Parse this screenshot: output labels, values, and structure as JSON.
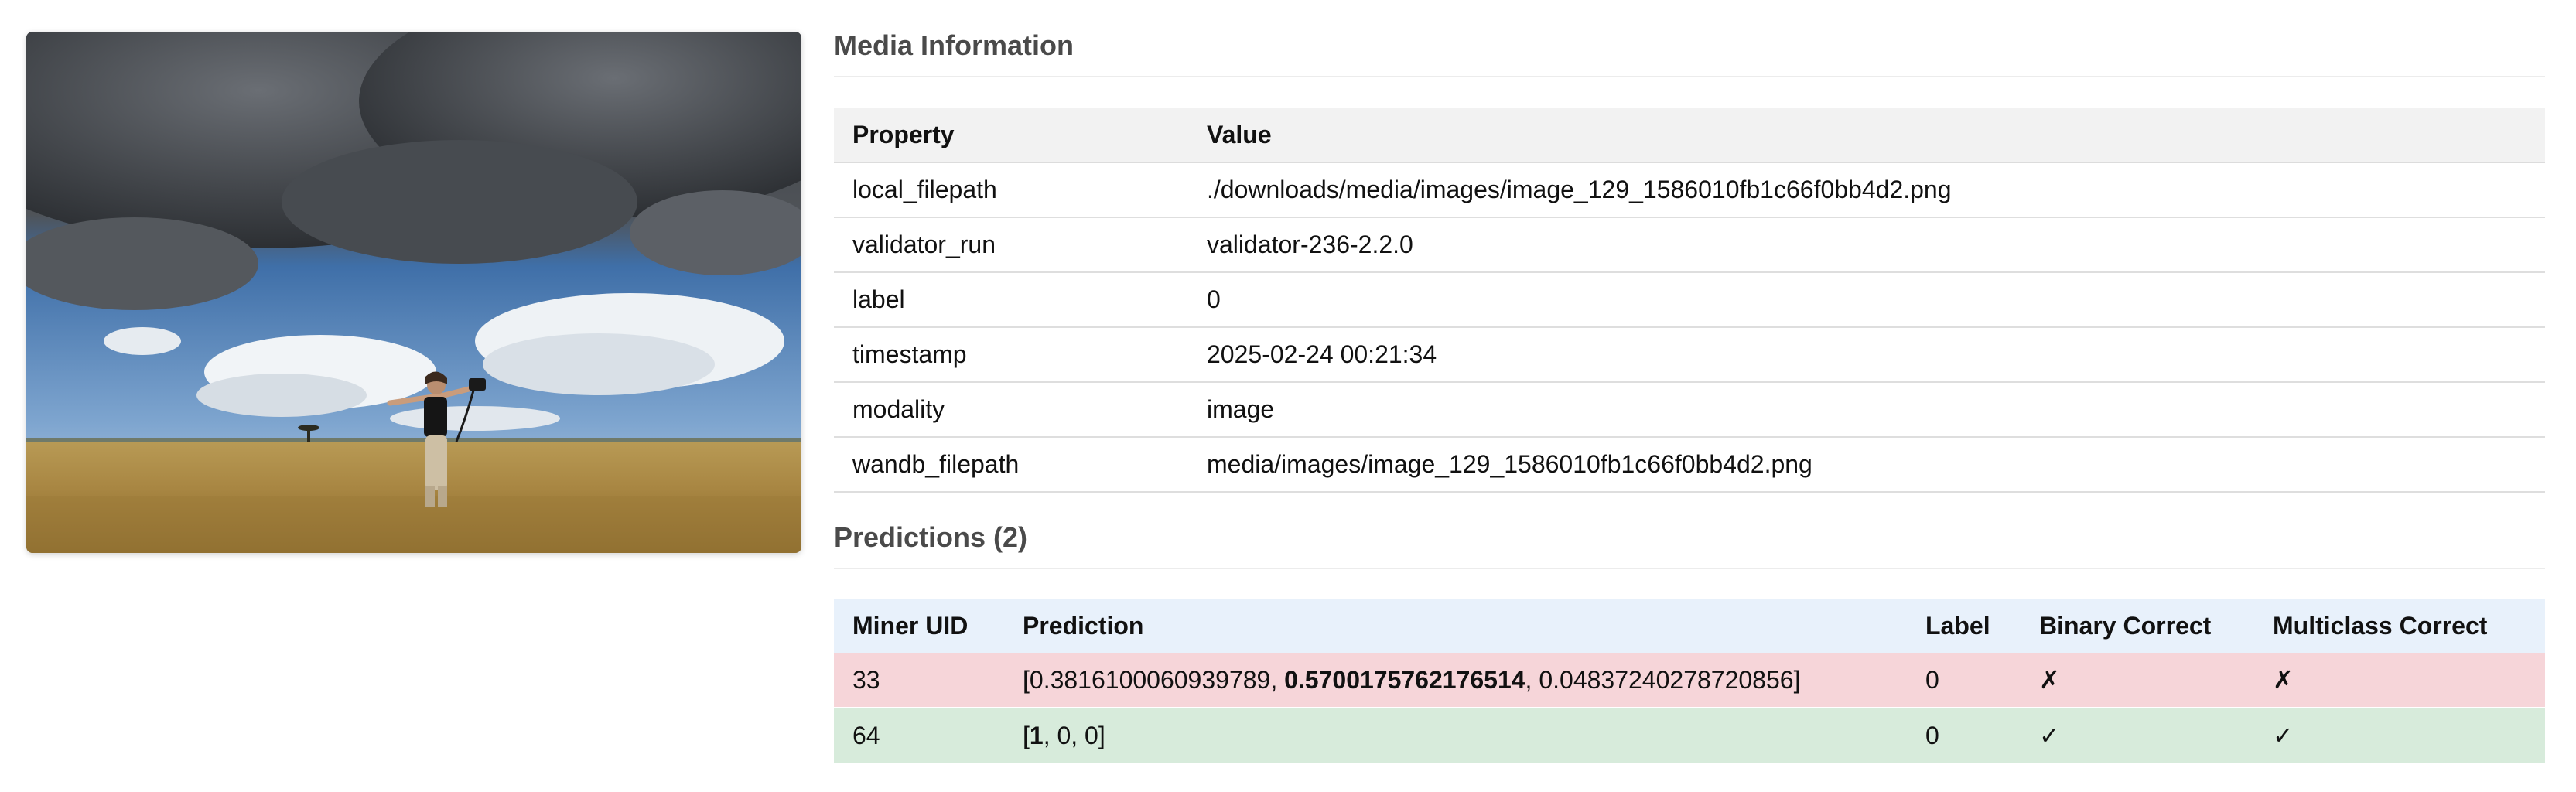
{
  "media": {
    "image_description_icon": "photo-icon"
  },
  "media_info": {
    "title": "Media Information",
    "headers": {
      "property": "Property",
      "value": "Value"
    },
    "rows": [
      {
        "property": "local_filepath",
        "value": "./downloads/media/images/image_129_1586010fb1c66f0bb4d2.png"
      },
      {
        "property": "validator_run",
        "value": "validator-236-2.2.0"
      },
      {
        "property": "label",
        "value": "0"
      },
      {
        "property": "timestamp",
        "value": "2025-02-24 00:21:34"
      },
      {
        "property": "modality",
        "value": "image"
      },
      {
        "property": "wandb_filepath",
        "value": "media/images/image_129_1586010fb1c66f0bb4d2.png"
      }
    ]
  },
  "predictions": {
    "title": "Predictions (2)",
    "headers": {
      "miner_uid": "Miner UID",
      "prediction": "Prediction",
      "label": "Label",
      "binary_correct": "Binary Correct",
      "multiclass_correct": "Multiclass Correct"
    },
    "rows": [
      {
        "miner_uid": "33",
        "prediction_parts": [
          "[0.3816100060939789, ",
          "0.5700175762176514",
          ", 0.04837240278720856]"
        ],
        "label": "0",
        "binary_correct": "✗",
        "multiclass_correct": "✗",
        "status": "incorrect"
      },
      {
        "miner_uid": "64",
        "prediction_parts": [
          "[",
          "1",
          ", 0, 0]"
        ],
        "label": "0",
        "binary_correct": "✓",
        "multiclass_correct": "✓",
        "status": "correct"
      }
    ]
  },
  "colors": {
    "incorrect_row": "#f6d5d9",
    "correct_row": "#d7ebdb",
    "pred_header": "#e8f1fb",
    "info_header": "#f2f2f2"
  }
}
